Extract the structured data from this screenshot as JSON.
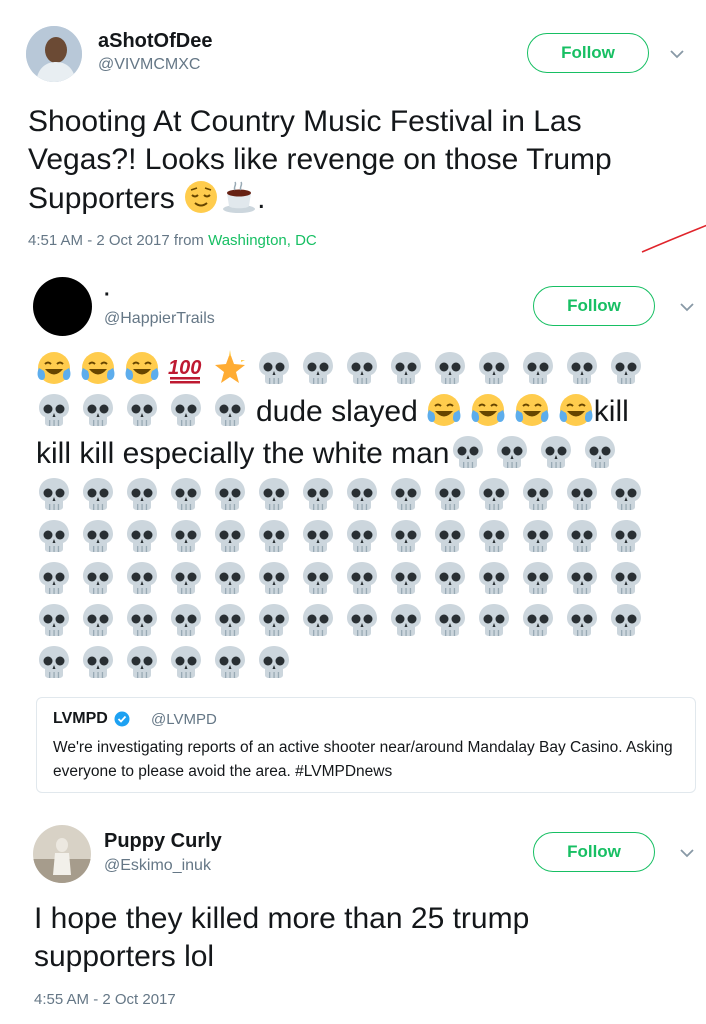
{
  "tweet1": {
    "name": "aShotOfDee",
    "handle": "@VIVMCMXC",
    "follow": "Follow",
    "text_line1": "Shooting At Country Music Festival in Las",
    "text_line2": "Vegas?! Looks like revenge on those Trump",
    "text_line3": "Supporters",
    "text_end": ".",
    "time": "4:51 AM - 2 Oct 2017 from",
    "location": "Washington, DC"
  },
  "tweet2": {
    "name": "·",
    "handle": "@HappierTrails",
    "follow": "Follow",
    "text_a": "dude slayed",
    "text_b": "kill",
    "text_c": "kill kill especially the white man"
  },
  "quote": {
    "name": "LVMPD",
    "handle": "@LVMPD",
    "text": "We're investigating reports of an active shooter near/around Mandalay Bay Casino. Asking everyone to please avoid the area. #LVMPDnews"
  },
  "tweet3": {
    "name": "Puppy Curly",
    "handle": "@Eskimo_inuk",
    "follow": "Follow",
    "text_line1": "I hope they killed more than 25 trump",
    "text_line2": "supporters lol",
    "time": "4:55 AM - 2 Oct 2017"
  },
  "colors": {
    "accent": "#17bf63",
    "muted": "#657786",
    "verified": "#1da1f2"
  }
}
